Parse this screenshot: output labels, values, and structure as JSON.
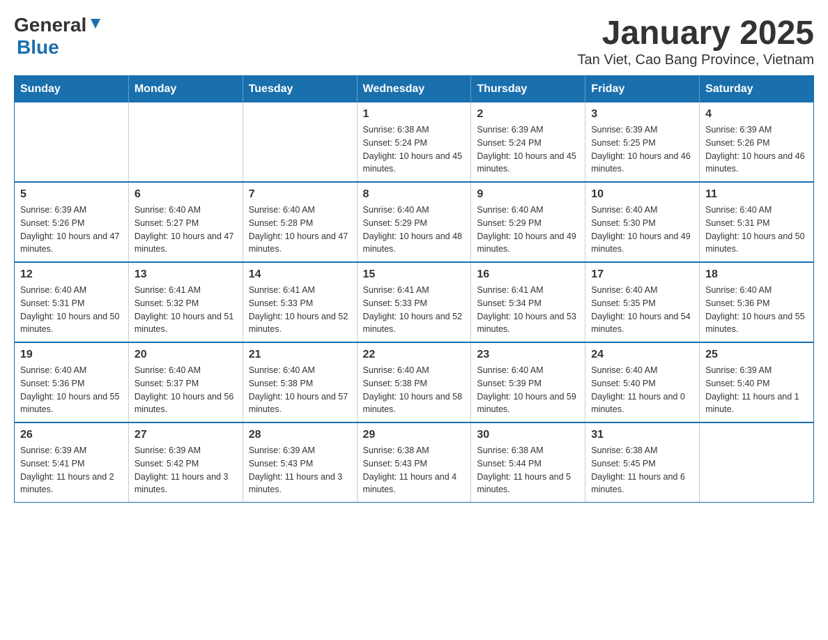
{
  "logo": {
    "general": "General",
    "blue": "Blue",
    "triangle": "▼"
  },
  "title": "January 2025",
  "subtitle": "Tan Viet, Cao Bang Province, Vietnam",
  "days_of_week": [
    "Sunday",
    "Monday",
    "Tuesday",
    "Wednesday",
    "Thursday",
    "Friday",
    "Saturday"
  ],
  "weeks": [
    [
      {
        "day": "",
        "info": ""
      },
      {
        "day": "",
        "info": ""
      },
      {
        "day": "",
        "info": ""
      },
      {
        "day": "1",
        "info": "Sunrise: 6:38 AM\nSunset: 5:24 PM\nDaylight: 10 hours and 45 minutes."
      },
      {
        "day": "2",
        "info": "Sunrise: 6:39 AM\nSunset: 5:24 PM\nDaylight: 10 hours and 45 minutes."
      },
      {
        "day": "3",
        "info": "Sunrise: 6:39 AM\nSunset: 5:25 PM\nDaylight: 10 hours and 46 minutes."
      },
      {
        "day": "4",
        "info": "Sunrise: 6:39 AM\nSunset: 5:26 PM\nDaylight: 10 hours and 46 minutes."
      }
    ],
    [
      {
        "day": "5",
        "info": "Sunrise: 6:39 AM\nSunset: 5:26 PM\nDaylight: 10 hours and 47 minutes."
      },
      {
        "day": "6",
        "info": "Sunrise: 6:40 AM\nSunset: 5:27 PM\nDaylight: 10 hours and 47 minutes."
      },
      {
        "day": "7",
        "info": "Sunrise: 6:40 AM\nSunset: 5:28 PM\nDaylight: 10 hours and 47 minutes."
      },
      {
        "day": "8",
        "info": "Sunrise: 6:40 AM\nSunset: 5:29 PM\nDaylight: 10 hours and 48 minutes."
      },
      {
        "day": "9",
        "info": "Sunrise: 6:40 AM\nSunset: 5:29 PM\nDaylight: 10 hours and 49 minutes."
      },
      {
        "day": "10",
        "info": "Sunrise: 6:40 AM\nSunset: 5:30 PM\nDaylight: 10 hours and 49 minutes."
      },
      {
        "day": "11",
        "info": "Sunrise: 6:40 AM\nSunset: 5:31 PM\nDaylight: 10 hours and 50 minutes."
      }
    ],
    [
      {
        "day": "12",
        "info": "Sunrise: 6:40 AM\nSunset: 5:31 PM\nDaylight: 10 hours and 50 minutes."
      },
      {
        "day": "13",
        "info": "Sunrise: 6:41 AM\nSunset: 5:32 PM\nDaylight: 10 hours and 51 minutes."
      },
      {
        "day": "14",
        "info": "Sunrise: 6:41 AM\nSunset: 5:33 PM\nDaylight: 10 hours and 52 minutes."
      },
      {
        "day": "15",
        "info": "Sunrise: 6:41 AM\nSunset: 5:33 PM\nDaylight: 10 hours and 52 minutes."
      },
      {
        "day": "16",
        "info": "Sunrise: 6:41 AM\nSunset: 5:34 PM\nDaylight: 10 hours and 53 minutes."
      },
      {
        "day": "17",
        "info": "Sunrise: 6:40 AM\nSunset: 5:35 PM\nDaylight: 10 hours and 54 minutes."
      },
      {
        "day": "18",
        "info": "Sunrise: 6:40 AM\nSunset: 5:36 PM\nDaylight: 10 hours and 55 minutes."
      }
    ],
    [
      {
        "day": "19",
        "info": "Sunrise: 6:40 AM\nSunset: 5:36 PM\nDaylight: 10 hours and 55 minutes."
      },
      {
        "day": "20",
        "info": "Sunrise: 6:40 AM\nSunset: 5:37 PM\nDaylight: 10 hours and 56 minutes."
      },
      {
        "day": "21",
        "info": "Sunrise: 6:40 AM\nSunset: 5:38 PM\nDaylight: 10 hours and 57 minutes."
      },
      {
        "day": "22",
        "info": "Sunrise: 6:40 AM\nSunset: 5:38 PM\nDaylight: 10 hours and 58 minutes."
      },
      {
        "day": "23",
        "info": "Sunrise: 6:40 AM\nSunset: 5:39 PM\nDaylight: 10 hours and 59 minutes."
      },
      {
        "day": "24",
        "info": "Sunrise: 6:40 AM\nSunset: 5:40 PM\nDaylight: 11 hours and 0 minutes."
      },
      {
        "day": "25",
        "info": "Sunrise: 6:39 AM\nSunset: 5:40 PM\nDaylight: 11 hours and 1 minute."
      }
    ],
    [
      {
        "day": "26",
        "info": "Sunrise: 6:39 AM\nSunset: 5:41 PM\nDaylight: 11 hours and 2 minutes."
      },
      {
        "day": "27",
        "info": "Sunrise: 6:39 AM\nSunset: 5:42 PM\nDaylight: 11 hours and 3 minutes."
      },
      {
        "day": "28",
        "info": "Sunrise: 6:39 AM\nSunset: 5:43 PM\nDaylight: 11 hours and 3 minutes."
      },
      {
        "day": "29",
        "info": "Sunrise: 6:38 AM\nSunset: 5:43 PM\nDaylight: 11 hours and 4 minutes."
      },
      {
        "day": "30",
        "info": "Sunrise: 6:38 AM\nSunset: 5:44 PM\nDaylight: 11 hours and 5 minutes."
      },
      {
        "day": "31",
        "info": "Sunrise: 6:38 AM\nSunset: 5:45 PM\nDaylight: 11 hours and 6 minutes."
      },
      {
        "day": "",
        "info": ""
      }
    ]
  ]
}
